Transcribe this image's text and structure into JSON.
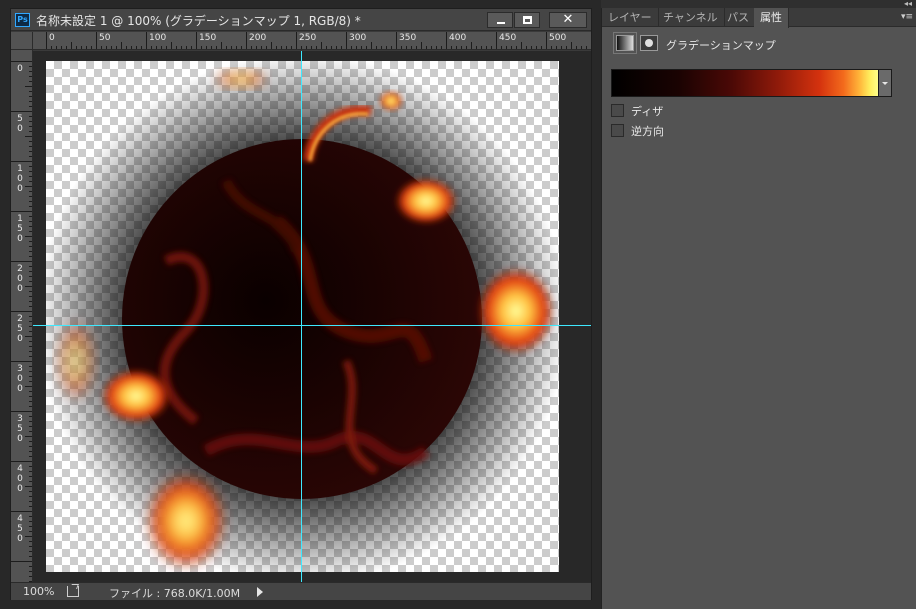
{
  "document": {
    "app_icon_text": "Ps",
    "title": "名称未設定 1 @ 100% (グラデーションマップ 1, RGB/8) *",
    "min_icon": "minimize-icon",
    "max_icon": "maximize-icon",
    "close_glyph": "✕"
  },
  "rulers": {
    "horizontal_labels": [
      "0",
      "50",
      "100",
      "150",
      "200",
      "250",
      "300",
      "350",
      "400",
      "450",
      "500"
    ],
    "vertical_labels": [
      "0",
      "5\n0",
      "1\n0\n0",
      "1\n5\n0",
      "2\n0\n0",
      "2\n5\n0",
      "3\n0\n0",
      "3\n5\n0",
      "4\n0\n0",
      "4\n5\n0"
    ]
  },
  "status": {
    "zoom": "100%",
    "file_info": "ファイル : 768.0K/1.00M"
  },
  "panel": {
    "tabs": [
      {
        "label": "レイヤー",
        "active": false
      },
      {
        "label": "チャンネル",
        "active": false
      },
      {
        "label": "パス",
        "active": false
      },
      {
        "label": "属性",
        "active": true
      }
    ],
    "adjustment_title": "グラデーションマップ",
    "gradient_colors": [
      "#000000",
      "#4b0906",
      "#d4320e",
      "#ffb53a",
      "#ffff88"
    ],
    "dither_label": "ディザ",
    "reverse_label": "逆方向",
    "dither_checked": false,
    "reverse_checked": false,
    "panel_menu_glyph": "▾≡",
    "collapse_glyph": "◂◂"
  }
}
